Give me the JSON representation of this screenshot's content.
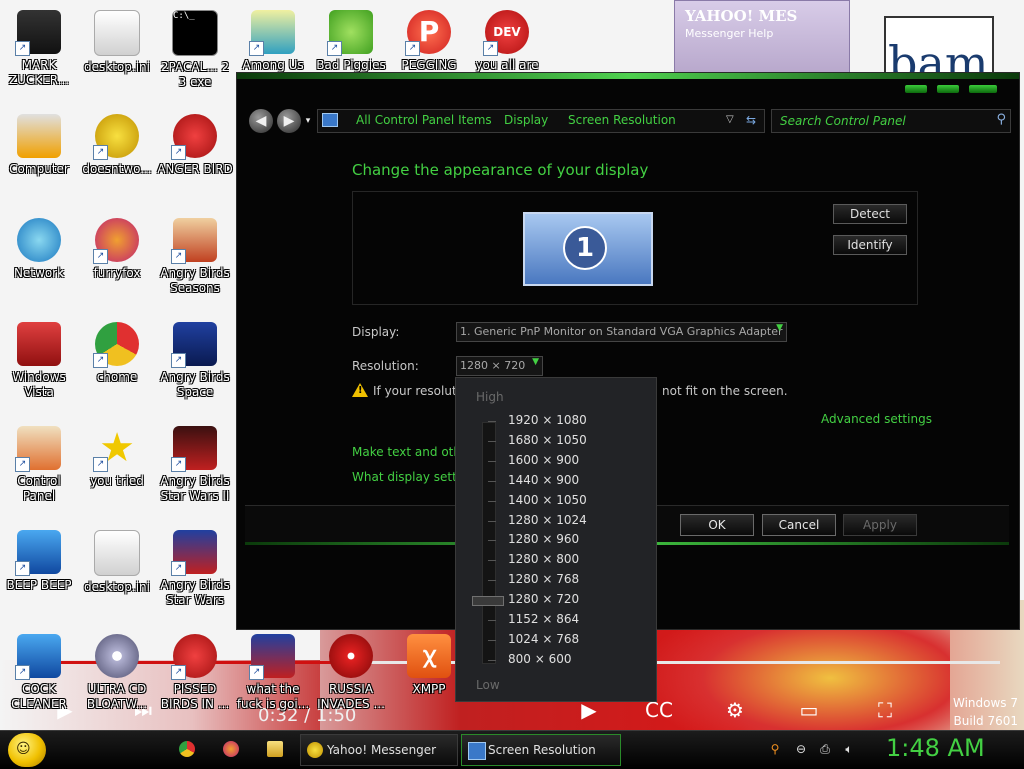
{
  "desktop": {
    "icons": [
      {
        "label": "MARK ZUCKER..."
      },
      {
        "label": "desktop.ini"
      },
      {
        "label": "2PACAL... 2 3 exe"
      },
      {
        "label": "Among Us"
      },
      {
        "label": "Bad Piggies"
      },
      {
        "label": "PEGGING"
      },
      {
        "label": "you all are"
      },
      {
        "label": "Computer"
      },
      {
        "label": "doesntwo..."
      },
      {
        "label": "ANGER BIRD"
      },
      {
        "label": "Network"
      },
      {
        "label": "furryfox"
      },
      {
        "label": "Angry Birds Seasons"
      },
      {
        "label": "Windows Vista"
      },
      {
        "label": "chome"
      },
      {
        "label": "Angry Birds Space"
      },
      {
        "label": "Control Panel"
      },
      {
        "label": "you tried"
      },
      {
        "label": "Angry Birds Star Wars II"
      },
      {
        "label": "BEEP BEEP"
      },
      {
        "label": "desktop.ini"
      },
      {
        "label": "Angry Birds Star Wars"
      },
      {
        "label": "COCK CLEANER"
      },
      {
        "label": "ULTRA CD BLOATW..."
      },
      {
        "label": "PISSED BIRDS IN ..."
      },
      {
        "label": "what the fuck is goi..."
      },
      {
        "label": "RUSSIA INVADES ..."
      },
      {
        "label": "XMPP"
      }
    ],
    "video_time": "0:32 / 1:50",
    "watermark_line1": "Windows 7",
    "watermark_line2": "Build 7601"
  },
  "yahoo_window": {
    "title": "YAHOO! MES",
    "menu": "Messenger   Help"
  },
  "bam_text": "bam",
  "window": {
    "breadcrumbs": [
      "All Control Panel Items",
      "Display",
      "Screen Resolution"
    ],
    "search_placeholder": "Search Control Panel",
    "heading": "Change the appearance of your display",
    "monitor_number": "1",
    "detect_label": "Detect",
    "identify_label": "Identify",
    "display_label": "Display:",
    "display_value": "1. Generic PnP Monitor on Standard VGA Graphics Adapter",
    "resolution_label": "Resolution:",
    "resolution_value": "1280 × 720",
    "warning_text_start": "If your resolutio",
    "warning_text_end": "not fit on the screen.",
    "advanced_settings": "Advanced settings",
    "link_text_size": "Make text and other",
    "link_display_settings": "What display setting",
    "ok_label": "OK",
    "cancel_label": "Cancel",
    "apply_label": "Apply"
  },
  "resolution_popup": {
    "high_label": "High",
    "low_label": "Low",
    "options": [
      "1920 × 1080",
      "1680 × 1050",
      "1600 × 900",
      "1440 × 900",
      "1400 × 1050",
      "1280 × 1024",
      "1280 × 960",
      "1280 × 800",
      "1280 × 768",
      "1280 × 720",
      "1152 × 864",
      "1024 × 768",
      "800 × 600"
    ],
    "selected_index": 9
  },
  "taskbar": {
    "buttons": [
      {
        "label": "Yahoo! Messenger"
      },
      {
        "label": "Screen Resolution"
      }
    ],
    "clock": "1:48 AM"
  },
  "colors": {
    "accent": "#43d043",
    "window_bg": "#050505",
    "popup_bg": "#222326"
  }
}
